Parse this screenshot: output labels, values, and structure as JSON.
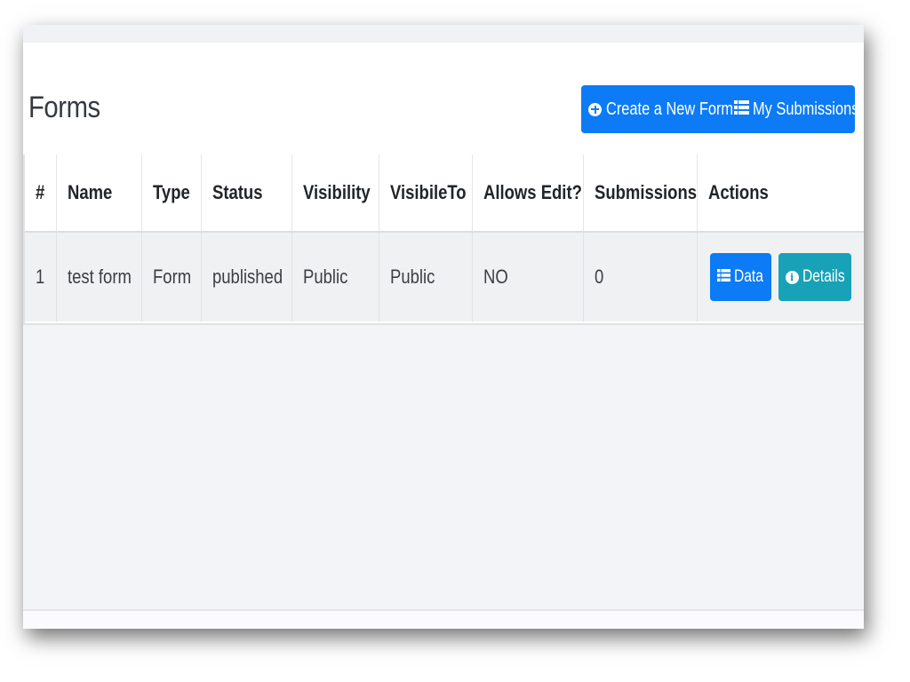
{
  "page": {
    "title": "Forms"
  },
  "toolbar": {
    "create_label": "Create a New Form",
    "submissions_label": "My Submissions"
  },
  "table": {
    "headers": [
      "#",
      "Name",
      "Type",
      "Status",
      "Visibility",
      "VisibileTo",
      "Allows Edit?",
      "Submissions",
      "Actions"
    ],
    "rows": [
      {
        "num": "1",
        "name": "test form",
        "type": "Form",
        "status": "published",
        "visibility": "Public",
        "visible_to": "Public",
        "allows_edit": "NO",
        "submissions": "0",
        "actions": {
          "data_label": "Data",
          "details_label": "Details"
        }
      }
    ]
  },
  "colors": {
    "primary": "#0d7bf5",
    "info": "#17a2b8",
    "page_bg": "#f3f4f8"
  },
  "icons": {
    "create": "plus-circle-icon",
    "submissions": "list-icon",
    "data": "list-icon",
    "details": "info-circle-icon"
  }
}
